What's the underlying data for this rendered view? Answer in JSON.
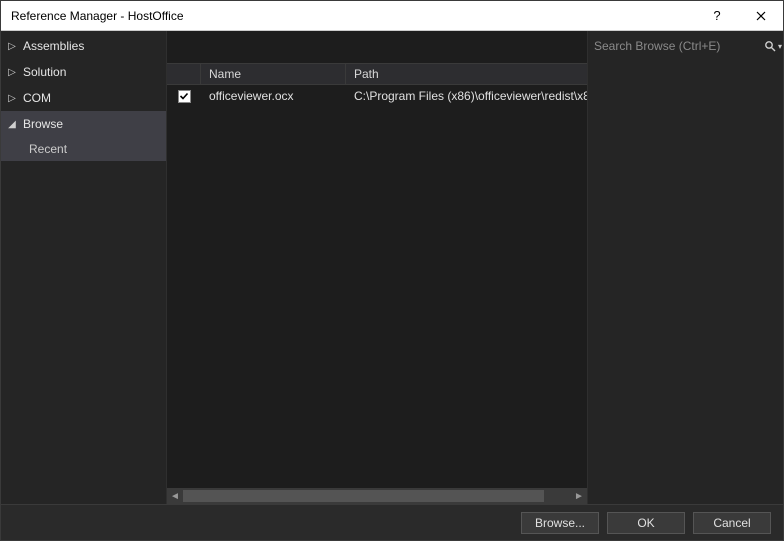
{
  "title": "Reference Manager - HostOffice",
  "search": {
    "placeholder": "Search Browse (Ctrl+E)"
  },
  "sidebar": {
    "items": [
      {
        "label": "Assemblies",
        "expanded": false,
        "selected": false
      },
      {
        "label": "Solution",
        "expanded": false,
        "selected": false
      },
      {
        "label": "COM",
        "expanded": false,
        "selected": false
      },
      {
        "label": "Browse",
        "expanded": true,
        "selected": true,
        "children": [
          {
            "label": "Recent",
            "selected": true
          }
        ]
      }
    ]
  },
  "list": {
    "columns": {
      "name": "Name",
      "path": "Path"
    },
    "rows": [
      {
        "checked": true,
        "name": "officeviewer.ocx",
        "path": "C:\\Program Files (x86)\\officeviewer\\redist\\x8"
      }
    ]
  },
  "footer": {
    "browse": "Browse...",
    "ok": "OK",
    "cancel": "Cancel"
  }
}
